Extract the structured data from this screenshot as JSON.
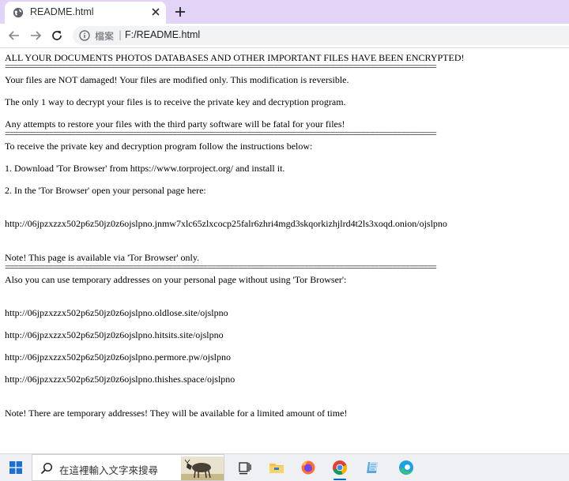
{
  "browser": {
    "tab": {
      "title": "README.html",
      "favicon": "globe-icon"
    },
    "toolbar": {
      "back_icon": "back-arrow-icon",
      "forward_icon": "forward-arrow-icon",
      "reload_icon": "reload-icon",
      "scheme_label": "檔案",
      "separator": "|",
      "url": "F:/README.html"
    }
  },
  "document": {
    "lines": {
      "l1": "ALL YOUR DOCUMENTS PHOTOS DATABASES AND OTHER IMPORTANT FILES HAVE BEEN ENCRYPTED!",
      "sep1": "==================================================================================================",
      "l2": "Your files are NOT damaged! Your files are modified only. This modification is reversible.",
      "l3": "The only 1 way to decrypt your files is to receive the private key and decryption program.",
      "l4": "Any attempts to restore your files with the third party software will be fatal for your files!",
      "sep2": "==================================================================================================",
      "l5": "To receive the private key and decryption program follow the instructions below:",
      "l6": "1. Download 'Tor Browser' from https://www.torproject.org/ and install it.",
      "l7": "2. In the 'Tor Browser' open your personal page here:",
      "l8": "http://06jpzxzzx502p6z50jz0z6ojslpno.jnmw7xlc65zlxcocp25falr6zhri4mgd3skqorkizhjlrd4t2ls3xoqd.onion/ojslpno",
      "l9": "Note! This page is available via 'Tor Browser' only.",
      "sep3": "==================================================================================================",
      "l10": "Also you can use temporary addresses on your personal page without using 'Tor Browser':",
      "l11": "http://06jpzxzzx502p6z50jz0z6ojslpno.oldlose.site/ojslpno",
      "l12": "http://06jpzxzzx502p6z50jz0z6ojslpno.hitsits.site/ojslpno",
      "l13": "http://06jpzxzzx502p6z50jz0z6ojslpno.permore.pw/ojslpno",
      "l14": "http://06jpzxzzx502p6z50jz0z6ojslpno.thishes.space/ojslpno",
      "l15": "Note! There are temporary addresses! They will be available for a limited amount of time!"
    }
  },
  "taskbar": {
    "search_placeholder": "在這裡輸入文字來搜尋",
    "apps": [
      "task-view-icon",
      "file-explorer-icon",
      "firefox-icon",
      "chrome-icon",
      "notepad-icon",
      "edge-icon"
    ],
    "colors": {
      "accent": "#0067c0",
      "tab_strip": "#e3d3f7"
    }
  }
}
